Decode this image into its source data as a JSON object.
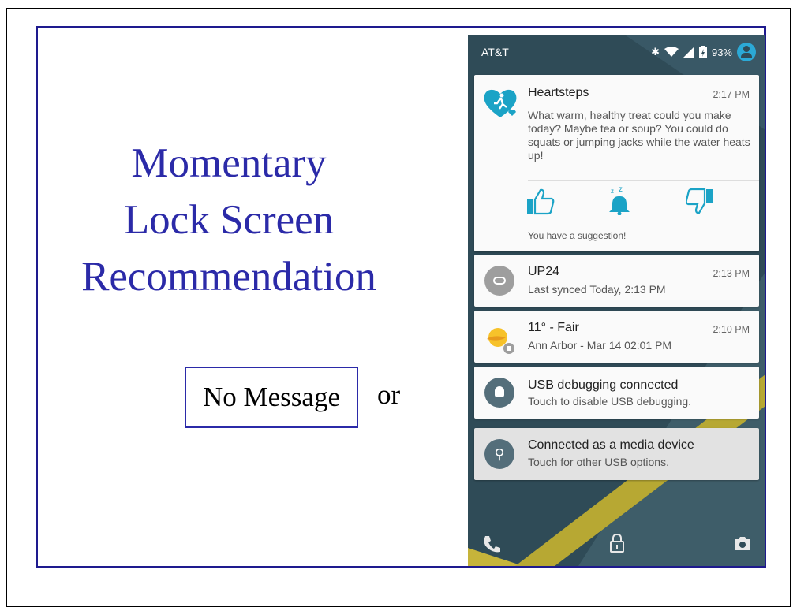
{
  "slide": {
    "title_lines": [
      "Momentary",
      "Lock Screen",
      "Recommendation"
    ],
    "no_message_label": "No Message",
    "or_label": "or"
  },
  "status_bar": {
    "carrier": "AT&T",
    "battery": "93%",
    "icons": [
      "bluetooth-icon",
      "wifi-icon",
      "signal-icon",
      "battery-icon",
      "avatar-icon"
    ]
  },
  "notifications": {
    "heartsteps": {
      "app": "Heartsteps",
      "time": "2:17 PM",
      "body": "What warm, healthy treat could you make today? Maybe tea or soup? You could do squats or jumping jacks while the water heats up!",
      "actions": [
        "thumbs-up-icon",
        "snooze-bell-icon",
        "thumbs-down-icon"
      ],
      "footer": "You have a suggestion!",
      "accent": "#1ba3c6"
    },
    "up24": {
      "title": "UP24",
      "time": "2:13 PM",
      "sub": "Last synced Today, 2:13 PM"
    },
    "weather": {
      "title": "11° -  Fair",
      "time": "2:10 PM",
      "sub": "Ann Arbor - Mar 14  02:01 PM"
    },
    "usb_debug": {
      "title": "USB debugging connected",
      "sub": "Touch to disable USB debugging."
    },
    "media": {
      "title": "Connected as a media device",
      "sub": "Touch for other USB options."
    }
  },
  "bottom_bar": [
    "phone-icon",
    "lock-icon",
    "camera-icon"
  ]
}
